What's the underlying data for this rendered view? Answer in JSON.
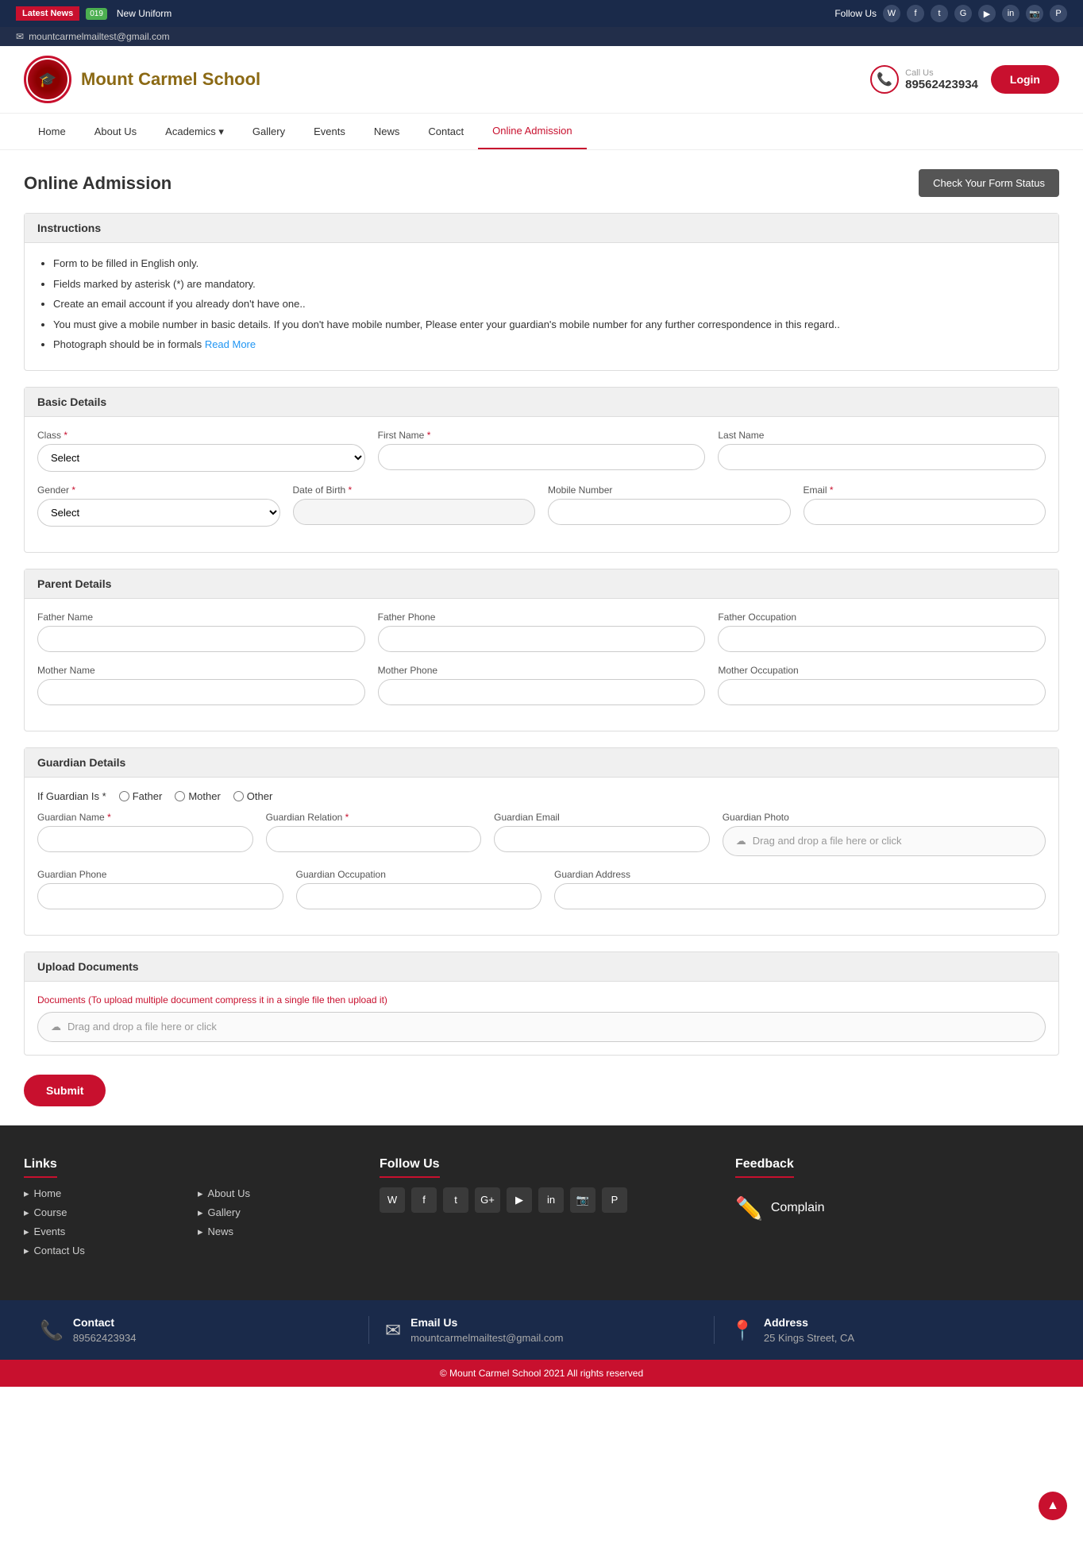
{
  "topbar": {
    "latest_news": "Latest News",
    "new_badge": "019",
    "news_text": "New Uniform",
    "email": "mountcarmelmailtest@gmail.com",
    "follow_us": "Follow Us"
  },
  "header": {
    "school_name": "Mount Carmel School",
    "call_us_label": "Call Us",
    "phone": "89562423934",
    "login_label": "Login"
  },
  "nav": {
    "items": [
      {
        "label": "Home",
        "active": false
      },
      {
        "label": "About Us",
        "active": false
      },
      {
        "label": "Academics",
        "active": false,
        "dropdown": true
      },
      {
        "label": "Gallery",
        "active": false
      },
      {
        "label": "Events",
        "active": false
      },
      {
        "label": "News",
        "active": false
      },
      {
        "label": "Contact",
        "active": false
      },
      {
        "label": "Online Admission",
        "active": true
      }
    ]
  },
  "page": {
    "title": "Online Admission",
    "check_status_btn": "Check Your Form Status"
  },
  "instructions": {
    "header": "Instructions",
    "items": [
      "Form to be filled in English only.",
      "Fields marked by asterisk (*) are mandatory.",
      "Create an email account if you already don't have one..",
      "You must give a mobile number in basic details. If you don't have mobile number, Please enter your guardian's mobile number for any further correspondence in this regard..",
      "Photograph should be in formals"
    ],
    "read_more": "Read More"
  },
  "basic_details": {
    "header": "Basic Details",
    "class_label": "Class",
    "class_placeholder": "Select",
    "first_name_label": "First Name",
    "last_name_label": "Last Name",
    "gender_label": "Gender",
    "gender_placeholder": "Select",
    "dob_label": "Date of Birth",
    "mobile_label": "Mobile Number",
    "email_label": "Email"
  },
  "parent_details": {
    "header": "Parent Details",
    "father_name_label": "Father Name",
    "father_phone_label": "Father Phone",
    "father_occupation_label": "Father Occupation",
    "mother_name_label": "Mother Name",
    "mother_phone_label": "Mother Phone",
    "mother_occupation_label": "Mother Occupation"
  },
  "guardian_details": {
    "header": "Guardian Details",
    "guardian_is_label": "If Guardian Is",
    "father_radio": "Father",
    "mother_radio": "Mother",
    "other_radio": "Other",
    "guardian_name_label": "Guardian Name",
    "guardian_relation_label": "Guardian Relation",
    "guardian_email_label": "Guardian Email",
    "guardian_photo_label": "Guardian Photo",
    "guardian_phone_label": "Guardian Phone",
    "guardian_occupation_label": "Guardian Occupation",
    "guardian_address_label": "Guardian Address",
    "drag_drop_photo": "Drag and drop a file here or click"
  },
  "upload_documents": {
    "header": "Upload Documents",
    "note": "Documents (To upload multiple document compress it in a single file then upload it)",
    "drag_drop": "Drag and drop a file here or click"
  },
  "form": {
    "submit_label": "Submit"
  },
  "footer": {
    "links_header": "Links",
    "links_col1": [
      "Home",
      "Course",
      "Events",
      "Contact Us"
    ],
    "links_col2": [
      "About Us",
      "Gallery",
      "News"
    ],
    "follow_header": "Follow Us",
    "feedback_header": "Feedback",
    "complain_label": "Complain",
    "social_icons": [
      "W",
      "f",
      "t",
      "G+",
      "▶",
      "in",
      "📷",
      "P"
    ]
  },
  "footer_bottom": {
    "contact_label": "Contact",
    "contact_value": "89562423934",
    "email_label": "Email Us",
    "email_value": "mountcarmelmailtest@gmail.com",
    "address_label": "Address",
    "address_value": "25 Kings Street, CA"
  },
  "copyright": {
    "text": "© Mount Carmel School 2021 All rights reserved"
  }
}
